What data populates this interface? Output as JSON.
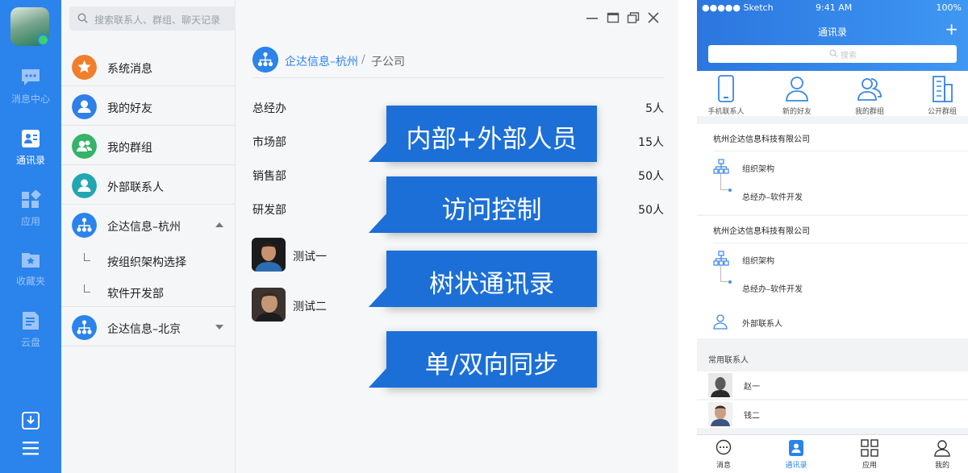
{
  "sidebar": {
    "items": [
      {
        "label": "消息中心",
        "icon": "chat-icon"
      },
      {
        "label": "通讯录",
        "icon": "contacts-icon"
      },
      {
        "label": "应用",
        "icon": "apps-icon"
      },
      {
        "label": "收藏夹",
        "icon": "favorites-icon"
      },
      {
        "label": "云盘",
        "icon": "cloud-drive-icon"
      }
    ],
    "active_color": "#ffffff",
    "bg_color": "#2b83ec"
  },
  "search": {
    "placeholder": "搜索联系人、群组、聊天记录"
  },
  "contact_list": {
    "groups": [
      {
        "label": "系统消息",
        "icon": "star-icon",
        "color": "#f07f2c"
      },
      {
        "label": "我的好友",
        "icon": "person-icon",
        "color": "#2f7fe8"
      },
      {
        "label": "我的群组",
        "icon": "group-icon",
        "color": "#35b368"
      },
      {
        "label": "外部联系人",
        "icon": "person-icon",
        "color": "#22a6b3"
      },
      {
        "label": "企达信息–杭州",
        "icon": "org-icon",
        "color": "#2b83ec"
      },
      {
        "label": "企达信息–北京",
        "icon": "org-icon",
        "color": "#2b83ec"
      }
    ],
    "sub_items": [
      "按组织架构选择",
      "软件开发部"
    ]
  },
  "main": {
    "breadcrumb": {
      "org": "企达信息–杭州",
      "separator": "/",
      "current": "子公司"
    },
    "departments": [
      {
        "name": "总经办",
        "count": "5人"
      },
      {
        "name": "市场部",
        "count": "15人"
      },
      {
        "name": "销售部",
        "count": "50人"
      },
      {
        "name": "研发部",
        "count": "50人"
      }
    ],
    "members": [
      {
        "name": "测试一"
      },
      {
        "name": "测试二"
      }
    ]
  },
  "callouts": [
    "内部+外部人员",
    "访问控制",
    "树状通讯录",
    "单/双向同步"
  ],
  "mobile": {
    "status": {
      "carrier": "●●●●● Sketch",
      "time": "9:41 AM",
      "battery": "100%"
    },
    "title": "通讯录",
    "search_placeholder": "搜索",
    "quick_actions": [
      "手机联系人",
      "新的好友",
      "我的群组",
      "公开群组"
    ],
    "cards": [
      {
        "company": "杭州企达信息科技有限公司",
        "org_label": "组织架构",
        "sub_label": "总经办–软件开发"
      },
      {
        "company": "杭州企达信息科技有限公司",
        "org_label": "组织架构",
        "sub_label": "总经办–软件开发"
      }
    ],
    "external": "外部联系人",
    "frequent_header": "常用联系人",
    "frequent": [
      "赵一",
      "钱二"
    ],
    "tabs": [
      "消息",
      "通讯录",
      "应用",
      "我的"
    ],
    "active_tab": "通讯录"
  }
}
